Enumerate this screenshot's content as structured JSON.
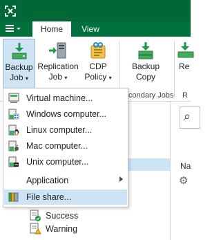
{
  "menubar": {
    "tabs": [
      {
        "label": "Home"
      },
      {
        "label": "View"
      }
    ]
  },
  "ribbon": {
    "buttons": [
      {
        "label_1": "Backup",
        "label_2": "Job"
      },
      {
        "label_1": "Replication",
        "label_2": "Job"
      },
      {
        "label_1": "CDP",
        "label_2": "Policy"
      },
      {
        "label_1": "Backup",
        "label_2": "Copy"
      },
      {
        "label_1": "Re"
      }
    ],
    "groups": [
      {
        "label": "condary Jobs"
      },
      {
        "label": "R"
      }
    ]
  },
  "dropdown": {
    "items": [
      {
        "label": "Virtual machine..."
      },
      {
        "label": "Windows computer..."
      },
      {
        "label": "Linux computer..."
      },
      {
        "label": "Mac computer..."
      },
      {
        "label": "Unix computer..."
      },
      {
        "label": "Application"
      },
      {
        "label": "File share..."
      }
    ]
  },
  "tree": {
    "items": [
      {
        "label": "Success"
      },
      {
        "label": "Warning"
      }
    ]
  },
  "main": {
    "name_column": "Na"
  },
  "colors": {
    "brand": "#006837",
    "highlight": "#cde4f7"
  }
}
